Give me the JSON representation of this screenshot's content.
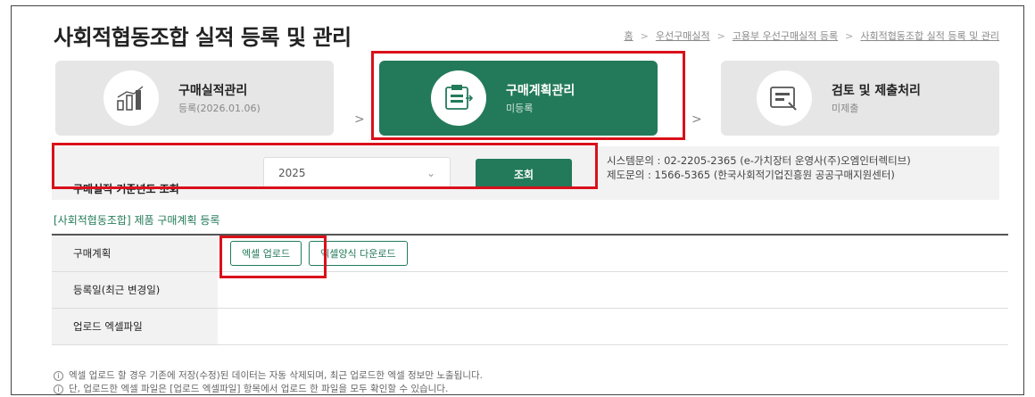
{
  "page": {
    "title": "사회적협동조합 실적 등록 및 관리"
  },
  "breadcrumb": [
    "홈",
    "우선구매실적",
    "고용부 우선구매실적 등록",
    "사회적협동조합 실적 등록 및 관리"
  ],
  "steps": [
    {
      "name": "구매실적관리",
      "sub": "등록(2026.01.06)",
      "icon": "chart-icon"
    },
    {
      "name": "구매계획관리",
      "sub": "미등록",
      "icon": "plan-icon",
      "active": true
    },
    {
      "name": "검토 및 제출처리",
      "sub": "미제출",
      "icon": "review-icon"
    }
  ],
  "search": {
    "label": "구매실적 기준년도 조회",
    "year": "2025",
    "button": "조회"
  },
  "contact": {
    "system": "시스템문의 : 02-2205-2365 (e-가치장터 운영사(주)오엠인터렉티브)",
    "policy": "제도문의 : 1566-5365 (한국사회적기업진흥원 공공구매지원센터)"
  },
  "section_title": "[사회적협동조합] 제품 구매계획 등록",
  "table": {
    "rows": [
      {
        "label": "구매계획"
      },
      {
        "label": "등록일(최근 변경일)"
      },
      {
        "label": "업로드 엑셀파일"
      }
    ],
    "upload_button": "엑셀 업로드",
    "download_button": "엑셀양식 다운로드"
  },
  "notes": [
    "엑셀 업로드 할 경우 기존에 저장(수정)된 데이터는 자동 삭제되며, 최근 업로드한 엑셀 정보만 노출됩니다.",
    "단, 업로드한 엑셀 파일은 [업로드 엑셀파일] 항목에서 업로드 한 파일을 모두 확인할 수 있습니다."
  ],
  "colors": {
    "accent": "#237a5a",
    "highlight": "#d9101a",
    "inactive_step": "#e6e6e6"
  }
}
